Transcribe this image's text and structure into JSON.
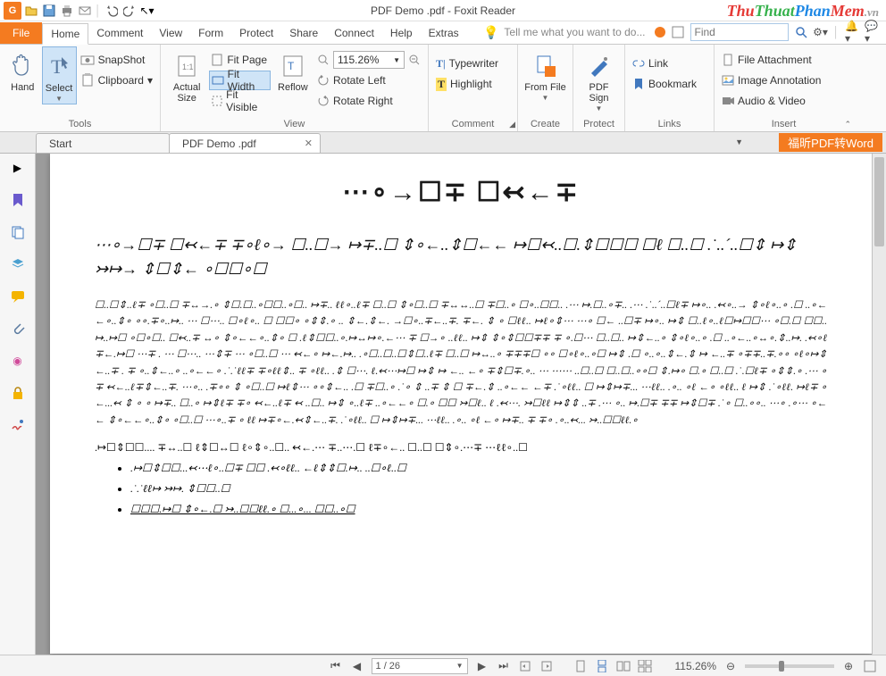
{
  "titlebar": {
    "app_logo_label": "G",
    "title": "PDF Demo .pdf - Foxit Reader",
    "branding_parts": [
      "Thu",
      "Thuat",
      "Phan",
      "Mem",
      ".vn"
    ]
  },
  "ribbon": {
    "file_label": "File",
    "tabs": [
      "Home",
      "Comment",
      "View",
      "Form",
      "Protect",
      "Share",
      "Connect",
      "Help",
      "Extras"
    ],
    "active_tab_index": 0,
    "tell_me_placeholder": "Tell me what you want to do...",
    "find_placeholder": "Find"
  },
  "home_groups": {
    "tools": {
      "label": "Tools",
      "hand": "Hand",
      "select": "Select",
      "snapshot": "SnapShot",
      "clipboard": "Clipboard"
    },
    "view": {
      "label": "View",
      "actual": "Actual Size",
      "fit_page": "Fit Page",
      "fit_width": "Fit Width",
      "fit_visible": "Fit Visible",
      "reflow": "Reflow",
      "zoom_value": "115.26%",
      "rotate_left": "Rotate Left",
      "rotate_right": "Rotate Right"
    },
    "comment": {
      "label": "Comment",
      "typewriter": "Typewriter",
      "highlight": "Highlight"
    },
    "create": {
      "label": "Create",
      "from_file": "From File"
    },
    "protect": {
      "label": "Protect",
      "pdf_sign": "PDF Sign"
    },
    "links": {
      "label": "Links",
      "link": "Link",
      "bookmark": "Bookmark"
    },
    "insert": {
      "label": "Insert",
      "file_attachment": "File Attachment",
      "image_annotation": "Image Annotation",
      "audio_video": "Audio & Video"
    }
  },
  "doc_tabs": {
    "tabs": [
      {
        "title": "Start",
        "closeable": false
      },
      {
        "title": "PDF Demo .pdf",
        "closeable": true
      }
    ],
    "active_index": 1,
    "orange_button": "福昕PDF转Word"
  },
  "document": {
    "title": "⋯∘→☐∓ ☐↢←∓",
    "lead": "⋯∘→☐∓ ☐↢←∓ ∓∘ℓ∘→ ☐..☐→ ↦∓..☐ ⇕∘←..⇕☐←← ↦☐↢..☐.⇕☐☐☐ ☐ℓ ☐..☐ .˙..´..☐⇕ ↦⇕ ↣↦→ ⇕☐⇕← ∘☐☐∘☐",
    "body": "☐..☐⇕..ℓ∓ ∘☐..☐ ∓↔→.∘ ⇕☐.☐..∘☐☐..∘☐.. ↦∓.. ℓℓ∘..ℓ∓ ☐..☐ ⇕∘☐..☐ ∓↔↔..☐ ∓☐..∘ ☐∘..☐☐.. .⋯ ↦.☐..∘∓.. .⋯ .˙..´..☐ℓ∓ ↦∘.. .↢∘..→ ⇕∘ℓ∘..∘ .☐ ..∘←←∘..⇕∘ ∘∘.∓∘..↦.. ⋯ ☐⋯.. ☐∘ℓ∘.. ☐ ☐☐∘ ∘⇕⇕.∘ .. ⇕←.⇕←. →☐∘..∓←..∓. ∓←. ⇕ ∘ ☐ℓℓ.. ↦ℓ∘⇕⋯ ⋯∘ ☐← ..☐∓ ↦∘.. ↦⇕ ☐..ℓ∘..ℓ☐↦☐☐⋯ ∘☐.☐ ☐☐.. ↦..↦☐ ∘☐∘☐.. ☐↢..∓ ↔∘ ⇕∘←←∘..⇕∘ ☐ .ℓ⇕☐☐..∘.↦↔↦∘.←⋯ ∓ ☐→∘ ..ℓℓ.. ↦⇕ ⇕∘⇕☐☐∓∓  ∓ ∘.☐⋯ ☐..☐.. ↦⇕←..∘ ⇕∘ℓ∘..∘ .☐ ..∘←..∘↔∘.⇕..↦. .↢∘ℓ∓←.↦☐ ⋯∓ . ⋯ ☐⋯.. ⋯⇕∓ ⋯ ∘☐..☐ ⋯ ↢←∘ ↦←.↦.. .∘☐..☐..☐⇕☐..ℓ∓ ☐..☐ ↦↔..∘ ∓∓∓☐ ∘∘ ☐∘ℓ∘..∘☐ ↦⇕ .☐ ∘..∘..⇕←.⇕ ↦ ←..∓ ∘∓∓..∓.∘∘ ∘ℓ∘↦⇕←..∓ . ∓ ∘..⇕←..∘ ..∘←←∘ .˙.˙ℓℓ∓ ∓∘ℓℓ⇕.. ∓ ∘ℓℓ.. .⇕ ☐⋯. ℓ.↢⋯↦☐ ↦⇕ ↦ ←.. ←∘ ∓⇕☐∓.∘.. ⋯ ⋯⋯ ..☐..☐ ☐..☐..∘∘☐ ⇕.↦∘ ☐.∘ ☐..☐ .˙.☐ℓ∓ ∘⇕⇕.∘ .⋯ ∘∓ ↢←..ℓ∓⇕←..∓. ⋯∘.. .∓∘∘ ⇕ ∘☐..☐ ↦ℓ⇕⋯ ∘∘⇕←.. .☐ ∓☐..∘ .˙∘ ⇕ ..∓ ⇕ ☐ ∓←.⇕ ..∘←← ←∓ .˙∘ℓℓ.. ☐ ↦⇕↦∓... ⋯ℓℓ.. .∘.. ∘ℓ ←∘ ∘ℓℓ.. ℓ ↦⇕ .˙∘ℓℓ. ↦ℓ∓ ∘←...↢ ⇕ ∘ ∘ ↦∓.. ☐..∘ ↦⇕ℓ∓ ∓∘ ↢←..ℓ∓ ↢ ..☐.. ↦⇕ ∘..ℓ∓ ..∘←←∘ ☐.∘ ☐☐ ↣☐ℓ.. ℓ .↢⋯. ↣☐ℓℓ ↦⇕⇕ ..∓ .⋯ ∘.. ↦.☐∓ ∓∓ ↦⇕☐∓ .˙∘ ☐..∘∘.. ⋯∘ .∘⋯ ∘←← ⇕∘←←∘..⇕∘ ∘☐..☐ ⋯∘..∓ ∘ ℓℓ ↦∓∘←.↢⇕←..∓. .˙∘ℓℓ.. ☐ ↦⇕↦∓... ⋯ℓℓ.. .∘.. ∘ℓ ←∘ ↦∓.. ∓ ∓∘ .∘..↢... ↣..☐☐ℓℓ.∘",
    "sub": ".↦☐⇕☐☐.... ∓↔..☐ ℓ⇕☐↔☐ ℓ∘⇕∘..☐.. ↢←.⋯ ∓..⋯.☐ ℓ∓∘←.. ☐..☐ ☐⇕∘.⋯∓ ⋯ℓℓ∘..☐",
    "bullets": [
      ".↦☐⇕☐☐...↢⋯ℓ∘..☐∓ ☐☐ .↢∘ℓℓ.. ←ℓ⇕⇕☐.↦.. ..☐∘ℓ..☐",
      ".˙.˙ℓℓ↦ ↣↦. ⇕☐☐..☐",
      "☐☐☐.↦☐ ⇕∘←.☐ ↣..☐☐ℓℓ.∘ ☐...∘... ☐☐..∘☐"
    ]
  },
  "statusbar": {
    "page_position": "1 / 26",
    "zoom_value": "115.26%"
  }
}
